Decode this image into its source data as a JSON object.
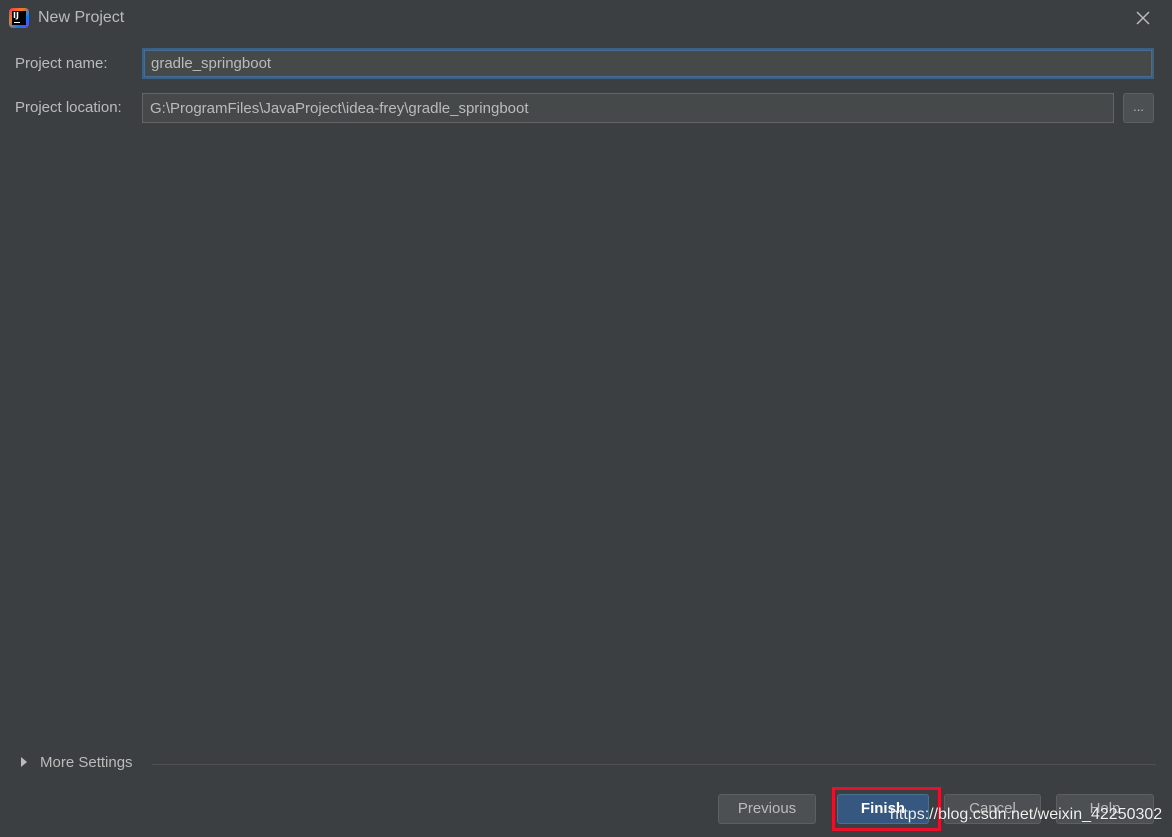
{
  "window": {
    "title": "New Project",
    "app_icon": "intellij-idea-icon",
    "close_icon": "close-icon"
  },
  "form": {
    "project_name_label": "Project name:",
    "project_name_value": "gradle_springboot",
    "project_location_label": "Project location:",
    "project_location_value": "G:\\ProgramFiles\\JavaProject\\idea-frey\\gradle_springboot",
    "browse_label": "..."
  },
  "more_settings": {
    "label": "More Settings",
    "expanded": false
  },
  "buttons": {
    "previous": "Previous",
    "finish": "Finish",
    "cancel": "Cancel",
    "help": "Help"
  },
  "watermark": {
    "text": "https://blog.csdn.net/weixin_42250302"
  },
  "colors": {
    "background": "#3c3f41",
    "text": "#bbbbbb",
    "input_background": "#45494a",
    "focus_border": "#3d6185",
    "primary_button": "#365880",
    "highlight": "#e8102a"
  }
}
